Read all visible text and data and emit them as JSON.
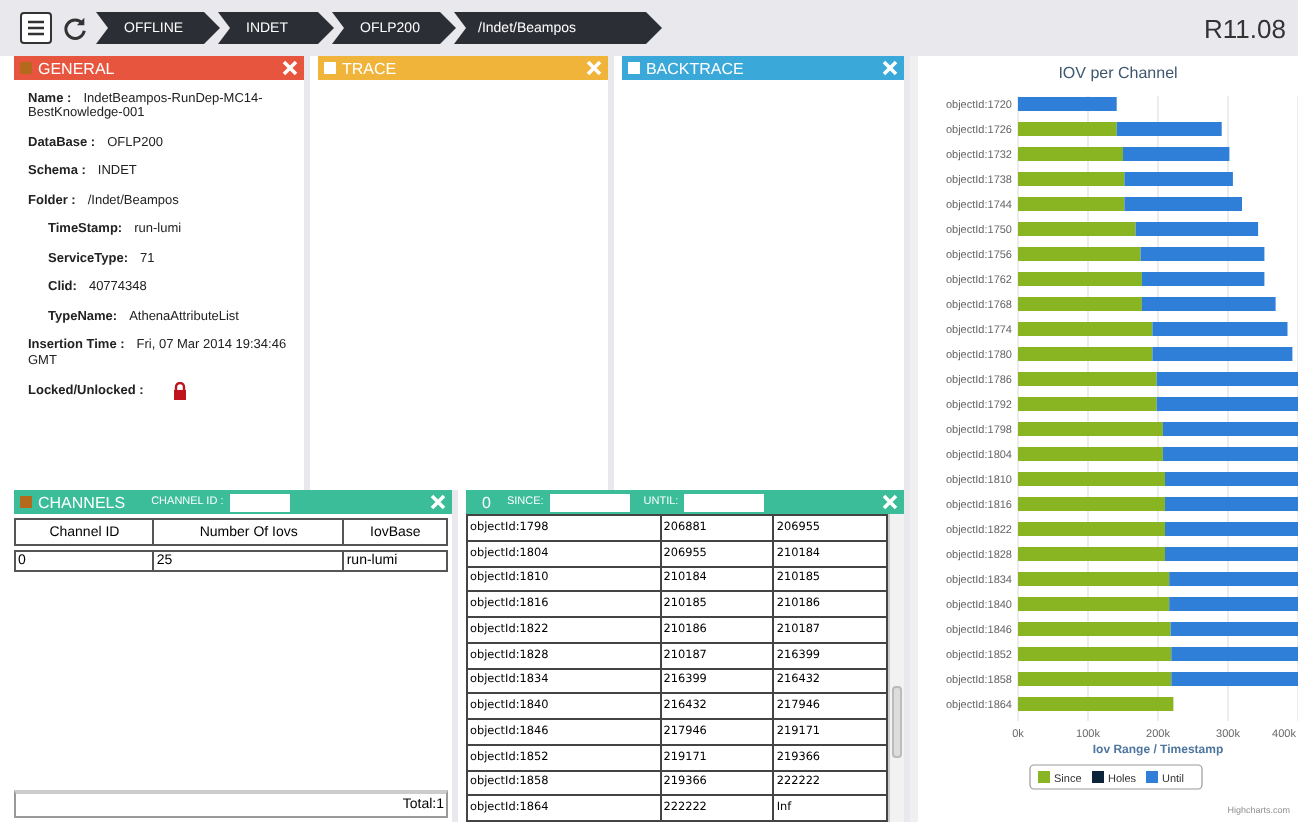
{
  "toolbar": {
    "breadcrumbs": [
      "OFFLINE",
      "INDET",
      "OFLP200",
      "/Indet/Beampos"
    ],
    "release": "R11.08"
  },
  "general": {
    "title": "GENERAL",
    "fields": [
      {
        "label": "Name :",
        "value": "IndetBeampos-RunDep-MC14-BestKnowledge-001",
        "nested": false
      },
      {
        "label": "DataBase :",
        "value": "OFLP200",
        "nested": false
      },
      {
        "label": "Schema :",
        "value": "INDET",
        "nested": false
      },
      {
        "label": "Folder :",
        "value": "/Indet/Beampos",
        "nested": false
      },
      {
        "label": "TimeStamp:",
        "value": "run-lumi",
        "nested": true
      },
      {
        "label": "ServiceType:",
        "value": "71",
        "nested": true
      },
      {
        "label": "Clid:",
        "value": "40774348",
        "nested": true
      },
      {
        "label": "TypeName:",
        "value": "AthenaAttributeList",
        "nested": true
      },
      {
        "label": "Insertion Time :",
        "value": "Fri, 07 Mar 2014 19:34:46 GMT",
        "nested": false
      }
    ],
    "lock_label": "Locked/Unlocked :",
    "locked": true
  },
  "trace": {
    "title": "TRACE"
  },
  "backtrace": {
    "title": "BACKTRACE"
  },
  "channels": {
    "title": "CHANNELS",
    "filter_label": "CHANNEL ID :",
    "columns": [
      "Channel ID",
      "Number Of Iovs",
      "IovBase"
    ],
    "rows": [
      [
        "0",
        "25",
        "run-lumi"
      ]
    ],
    "total": "Total:1"
  },
  "iovs": {
    "count": "0",
    "since_label": "SINCE:",
    "until_label": "UNTIL:",
    "rows": [
      [
        "objectId:1798",
        "206881",
        "206955"
      ],
      [
        "objectId:1804",
        "206955",
        "210184"
      ],
      [
        "objectId:1810",
        "210184",
        "210185"
      ],
      [
        "objectId:1816",
        "210185",
        "210186"
      ],
      [
        "objectId:1822",
        "210186",
        "210187"
      ],
      [
        "objectId:1828",
        "210187",
        "216399"
      ],
      [
        "objectId:1834",
        "216399",
        "216432"
      ],
      [
        "objectId:1840",
        "216432",
        "217946"
      ],
      [
        "objectId:1846",
        "217946",
        "219171"
      ],
      [
        "objectId:1852",
        "219171",
        "219366"
      ],
      [
        "objectId:1858",
        "219366",
        "222222"
      ],
      [
        "objectId:1864",
        "222222",
        "Inf"
      ]
    ]
  },
  "chart": {
    "credit": "Highcharts.com",
    "chart_data": {
      "type": "bar",
      "orientation": "horizontal",
      "stacked": true,
      "title": "IOV per Channel",
      "xlabel": "Iov Range / Timestamp",
      "categories": [
        "objectId:1720",
        "objectId:1726",
        "objectId:1732",
        "objectId:1738",
        "objectId:1744",
        "objectId:1750",
        "objectId:1756",
        "objectId:1762",
        "objectId:1768",
        "objectId:1774",
        "objectId:1780",
        "objectId:1786",
        "objectId:1792",
        "objectId:1798",
        "objectId:1804",
        "objectId:1810",
        "objectId:1816",
        "objectId:1822",
        "objectId:1828",
        "objectId:1834",
        "objectId:1840",
        "objectId:1846",
        "objectId:1852",
        "objectId:1858",
        "objectId:1864"
      ],
      "xlim": [
        0,
        400000
      ],
      "grid": true,
      "legend": true,
      "xticks": [
        {
          "value": 0,
          "label": "0k"
        },
        {
          "value": 100000,
          "label": "100k"
        },
        {
          "value": 200000,
          "label": "200k"
        },
        {
          "value": 300000,
          "label": "300k"
        },
        {
          "value": 400000,
          "label": "400k"
        }
      ],
      "series": [
        {
          "name": "Since",
          "color": "#8ab522",
          "values": [
            0,
            141000,
            150000,
            152000,
            152000,
            168000,
            175000,
            177000,
            177000,
            192000,
            192000,
            198000,
            198000,
            207000,
            207000,
            210000,
            210000,
            210000,
            210000,
            216000,
            216000,
            218000,
            219000,
            219000,
            222000
          ]
        },
        {
          "name": "Holes",
          "color": "#0d233a",
          "values": [
            0,
            0,
            0,
            0,
            0,
            0,
            0,
            0,
            0,
            0,
            0,
            0,
            0,
            0,
            0,
            0,
            0,
            0,
            0,
            0,
            0,
            0,
            0,
            0,
            0
          ]
        },
        {
          "name": "Until",
          "color": "#2f7ed8",
          "values": [
            141000,
            150000,
            152000,
            155000,
            168000,
            175000,
            177000,
            175000,
            191000,
            193000,
            200000,
            202000,
            202000,
            193000,
            193000,
            190000,
            190000,
            190000,
            190000,
            184000,
            184000,
            182000,
            181000,
            181000,
            null
          ]
        }
      ]
    }
  }
}
